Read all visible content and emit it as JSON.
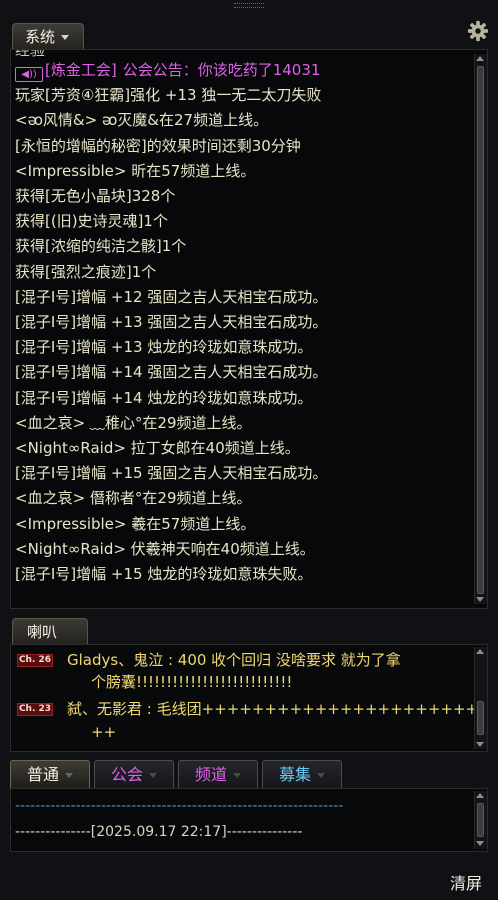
{
  "system_tab": {
    "label": "系统"
  },
  "system_lines": [
    {
      "text": "经验",
      "color": "#d0ccb0"
    },
    {
      "guild_tag": "[炼金工会]",
      "text": "公会公告：你该吃药了14031",
      "color": "#e060e8"
    },
    {
      "text": " 玩家[芳资④狂霸]强化 +13 独一无二太刀失败",
      "color": "#e8e4c8"
    },
    {
      "text": "<ᴔ风情&> ᴔ灭魔&在27频道上线。",
      "color": "#e8e4c8"
    },
    {
      "text": "[永恒的增幅的秘密]的效果时间还剩30分钟",
      "color": "#e8e4c8"
    },
    {
      "text": "<Impressible>   昕在57频道上线。",
      "color": "#e8e4c8"
    },
    {
      "text": "获得[无色小晶块]328个",
      "color": "#e8e4c8"
    },
    {
      "text": "获得[(旧)史诗灵魂]1个",
      "color": "#e8e4c8"
    },
    {
      "text": "获得[浓缩的纯洁之骸]1个",
      "color": "#e8e4c8"
    },
    {
      "text": "获得[强烈之痕迹]1个",
      "color": "#e8e4c8"
    },
    {
      "text": " [混子I号]增幅 +12 强固之吉人天相宝石成功。",
      "color": "#e8e4c8"
    },
    {
      "text": " [混子I号]增幅 +13 强固之吉人天相宝石成功。",
      "color": "#e8e4c8"
    },
    {
      "text": " [混子I号]增幅 +13 烛龙的玲珑如意珠成功。",
      "color": "#e8e4c8"
    },
    {
      "text": " [混子I号]增幅 +14 强固之吉人天相宝石成功。",
      "color": "#e8e4c8"
    },
    {
      "text": " [混子I号]增幅 +14 烛龙的玲珑如意珠成功。",
      "color": "#e8e4c8"
    },
    {
      "text": "<血之哀>   ﹏稚心°在29频道上线。",
      "color": "#e8e4c8"
    },
    {
      "text": "<Night∞Raid> 拉丁女郎在40频道上线。",
      "color": "#e8e4c8"
    },
    {
      "text": " [混子I号]增幅 +15 强固之吉人天相宝石成功。",
      "color": "#e8e4c8"
    },
    {
      "text": "<血之哀>   僭称者°在29频道上线。",
      "color": "#e8e4c8"
    },
    {
      "text": "<Impressible>    羲在57频道上线。",
      "color": "#e8e4c8"
    },
    {
      "text": "<Night∞Raid> 伏羲神天响在40频道上线。",
      "color": "#e8e4c8"
    },
    {
      "text": " [混子I号]增幅 +15 烛龙的玲珑如意珠失败。",
      "color": "#e8e4c8"
    }
  ],
  "horn_tab": {
    "label": "喇叭"
  },
  "horn_messages": [
    {
      "channel": "Ch. 26",
      "line1": "Gladys、鬼泣 : 400  收个回归   没啥要求  就为了拿",
      "line2": "个膀囊!!!!!!!!!!!!!!!!!!!!!!!!!!"
    },
    {
      "channel": "Ch. 23",
      "line1": "弑、无影君 : 毛线团++++++++++++++++++++++++++++++++",
      "line2": "++"
    }
  ],
  "chat_tabs": [
    {
      "label": "普通",
      "color": "#f5f2e0",
      "active": true
    },
    {
      "label": "公会",
      "color": "#e060e8",
      "active": false
    },
    {
      "label": "频道",
      "color": "#e060e8",
      "active": false
    },
    {
      "label": "募集",
      "color": "#6cc8f0",
      "active": false
    }
  ],
  "chat_lines": [
    {
      "text": "-----------------------------------------------------------------",
      "color": "#4a90c8"
    },
    {
      "text": "---------------[2025.09.17  22:17]---------------",
      "color": "#d8d4c0"
    }
  ],
  "clear_button": {
    "label": "清屏"
  },
  "icons": {
    "settings": "gear-icon",
    "speaker": "speaker-icon"
  }
}
